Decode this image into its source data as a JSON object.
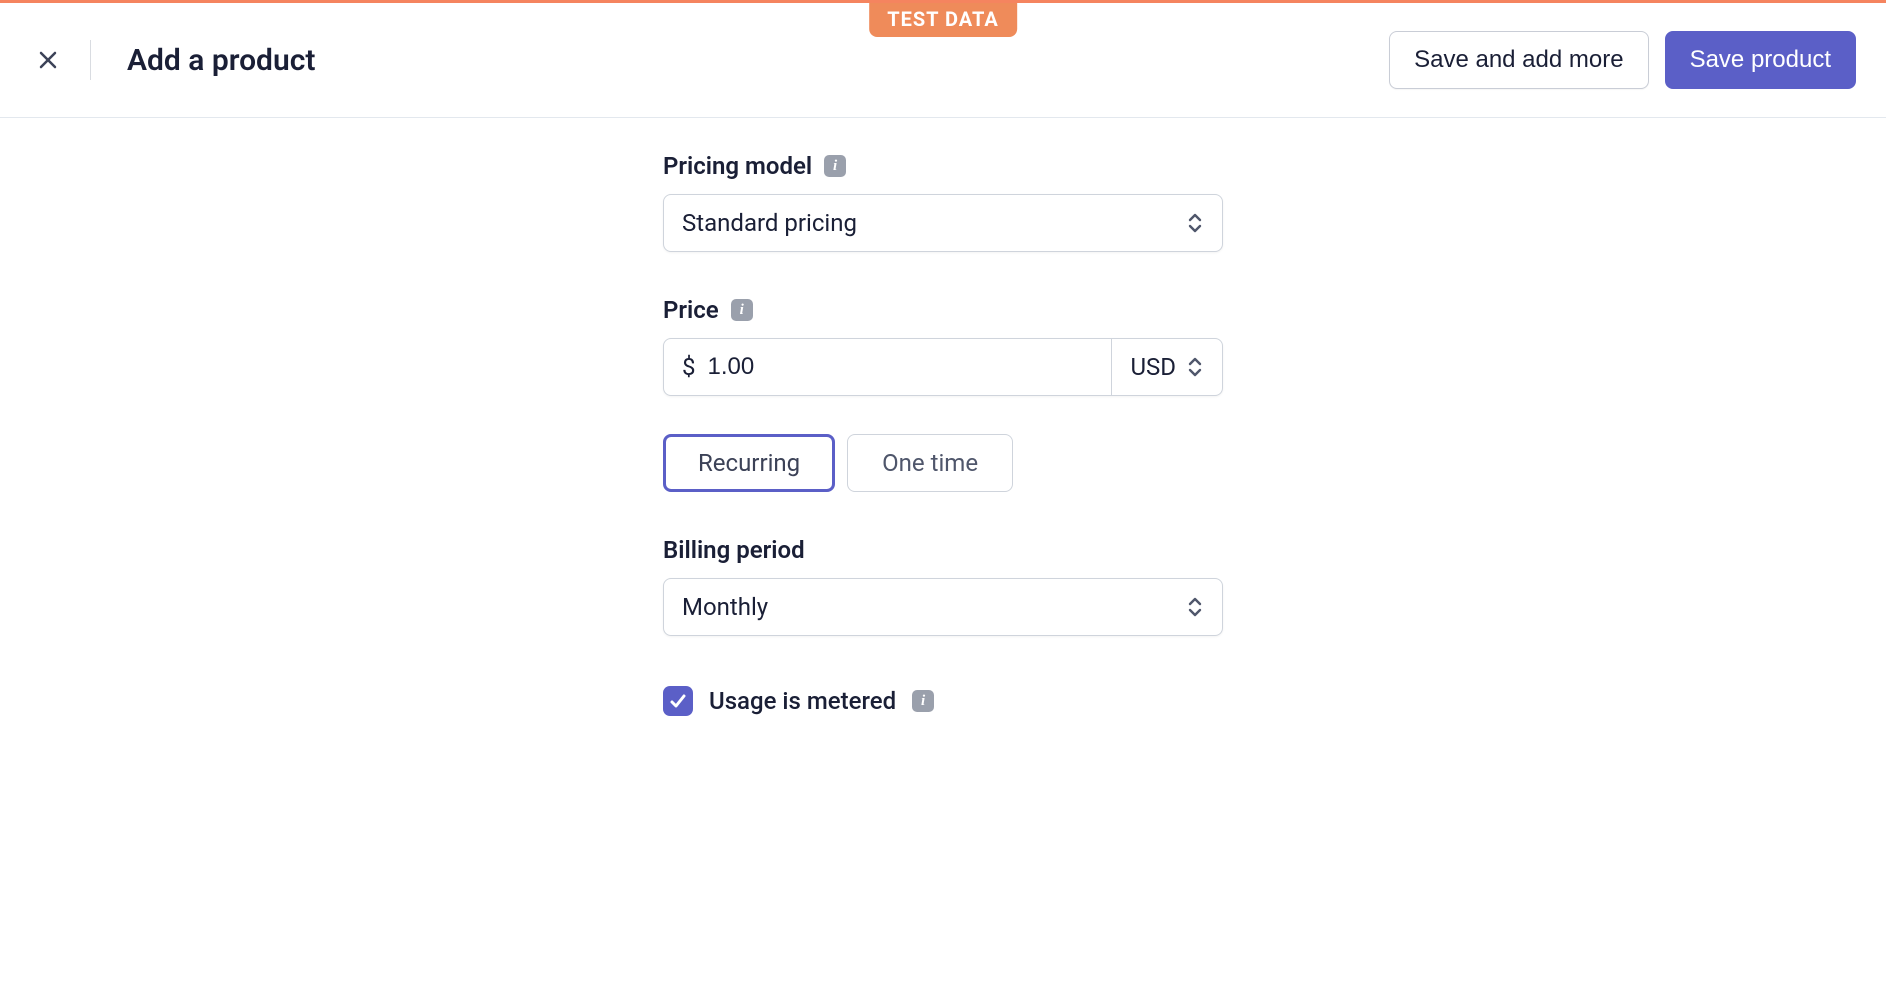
{
  "badge": "TEST DATA",
  "header": {
    "title": "Add a product",
    "save_more_label": "Save and add more",
    "save_label": "Save product"
  },
  "form": {
    "pricing_model": {
      "label": "Pricing model",
      "value": "Standard pricing"
    },
    "price": {
      "label": "Price",
      "symbol": "$",
      "value": "1.00",
      "currency": "USD"
    },
    "recurrence": {
      "recurring": "Recurring",
      "one_time": "One time"
    },
    "billing_period": {
      "label": "Billing period",
      "value": "Monthly"
    },
    "metered": {
      "label": "Usage is metered",
      "checked": true
    }
  }
}
